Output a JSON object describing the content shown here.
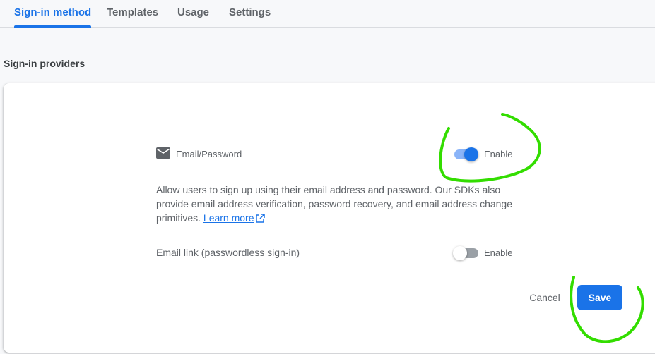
{
  "tabs": [
    {
      "label": "Sign-in method",
      "active": true
    },
    {
      "label": "Templates",
      "active": false
    },
    {
      "label": "Usage",
      "active": false
    },
    {
      "label": "Settings",
      "active": false
    }
  ],
  "section_title": "Sign-in providers",
  "email_password": {
    "icon": "mail-icon",
    "name": "Email/Password",
    "enabled": true,
    "toggle_label": "Enable",
    "description": "Allow users to sign up using their email address and password. Our SDKs also provide email address verification, password recovery, and email address change primitives.",
    "learn_more": "Learn more"
  },
  "email_link": {
    "name": "Email link (passwordless sign-in)",
    "enabled": false,
    "toggle_label": "Enable"
  },
  "actions": {
    "cancel": "Cancel",
    "save": "Save"
  },
  "colors": {
    "accent": "#1a73e8",
    "annotation": "#33dd00"
  }
}
